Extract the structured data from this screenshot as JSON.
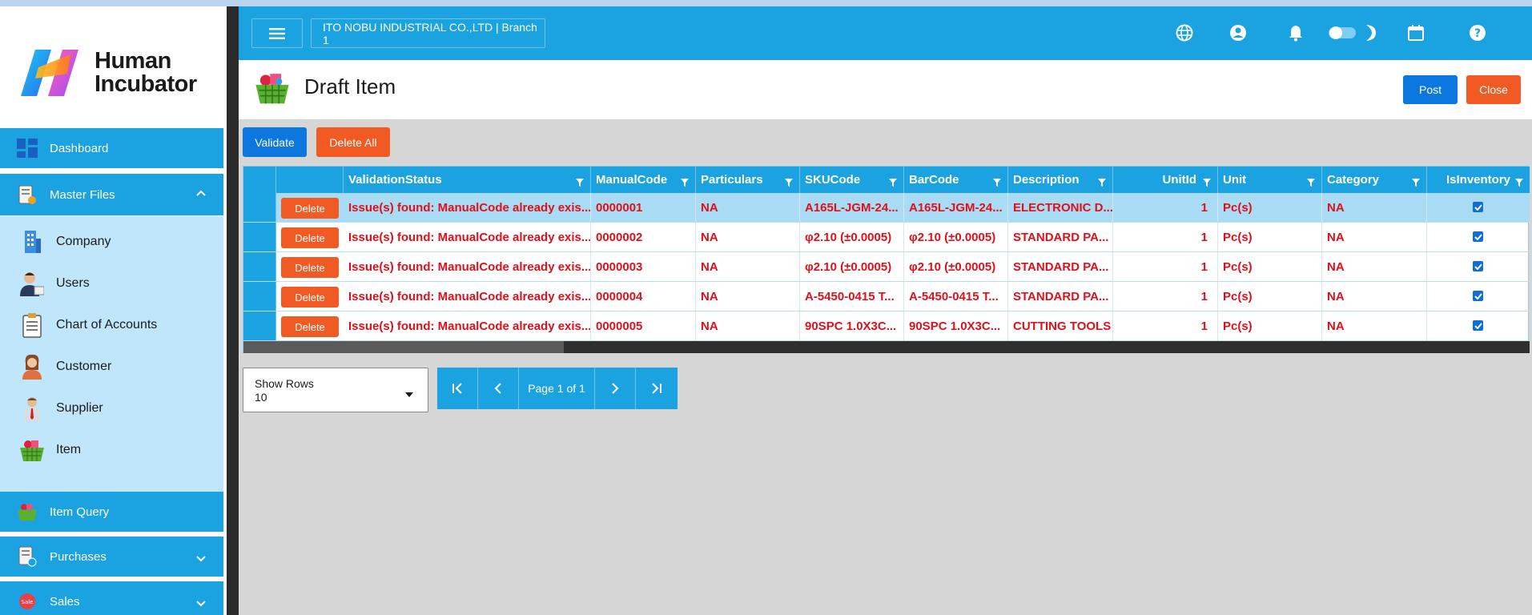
{
  "sidebar": {
    "logo_line1": "Human",
    "logo_line2": "Incubator",
    "top_items": [
      {
        "label": "Dashboard",
        "icon": "dashboard-icon"
      },
      {
        "label": "Master Files",
        "icon": "master-files-icon"
      }
    ],
    "sub_items": [
      {
        "label": "Company",
        "icon": "company-building-icon"
      },
      {
        "label": "Users",
        "icon": "users-icon"
      },
      {
        "label": "Chart of Accounts",
        "icon": "chart-of-accounts-icon"
      },
      {
        "label": "Customer",
        "icon": "customer-icon"
      },
      {
        "label": "Supplier",
        "icon": "supplier-icon"
      },
      {
        "label": "Item",
        "icon": "item-basket-icon"
      }
    ],
    "bottom_items": [
      {
        "label": "Item Query",
        "icon": "item-query-icon"
      },
      {
        "label": "Purchases",
        "icon": "purchases-icon"
      },
      {
        "label": "Sales",
        "icon": "sales-icon"
      }
    ]
  },
  "topbar": {
    "company": "ITO NOBU INDUSTRIAL CO.,LTD | Branch 1",
    "icons": [
      "globe-icon",
      "account-icon",
      "bell-icon",
      "theme-toggle-icon",
      "moon-icon",
      "calendar-icon",
      "help-icon"
    ]
  },
  "page": {
    "title": "Draft Item",
    "post_label": "Post",
    "close_label": "Close",
    "validate_label": "Validate",
    "delete_all_label": "Delete All"
  },
  "grid": {
    "columns": [
      "ValidationStatus",
      "ManualCode",
      "Particulars",
      "SKUCode",
      "BarCode",
      "Description",
      "UnitId",
      "Unit",
      "Category",
      "IsInventory"
    ],
    "delete_label": "Delete",
    "rows": [
      {
        "status": "Issue(s) found: ManualCode already exis...",
        "manual": "0000001",
        "particulars": "NA",
        "sku": "A165L-JGM-24...",
        "barcode": "A165L-JGM-24...",
        "description": "ELECTRONIC D...",
        "unitid": "1",
        "unit": "Pc(s)",
        "category": "NA",
        "inventory": true
      },
      {
        "status": "Issue(s) found: ManualCode already exis...",
        "manual": "0000002",
        "particulars": "NA",
        "sku": "φ2.10 (±0.0005)",
        "barcode": "φ2.10 (±0.0005)",
        "description": "STANDARD PA...",
        "unitid": "1",
        "unit": "Pc(s)",
        "category": "NA",
        "inventory": true
      },
      {
        "status": "Issue(s) found: ManualCode already exis...",
        "manual": "0000003",
        "particulars": "NA",
        "sku": "φ2.10 (±0.0005)",
        "barcode": "φ2.10 (±0.0005)",
        "description": "STANDARD PA...",
        "unitid": "1",
        "unit": "Pc(s)",
        "category": "NA",
        "inventory": true
      },
      {
        "status": "Issue(s) found: ManualCode already exis...",
        "manual": "0000004",
        "particulars": "NA",
        "sku": "A-5450-0415 T...",
        "barcode": "A-5450-0415 T...",
        "description": "STANDARD PA...",
        "unitid": "1",
        "unit": "Pc(s)",
        "category": "NA",
        "inventory": true
      },
      {
        "status": "Issue(s) found: ManualCode already exis...",
        "manual": "0000005",
        "particulars": "NA",
        "sku": "90SPC 1.0X3C...",
        "barcode": "90SPC 1.0X3C...",
        "description": "CUTTING TOOLS",
        "unitid": "1",
        "unit": "Pc(s)",
        "category": "NA",
        "inventory": true
      }
    ]
  },
  "pager": {
    "show_rows_label": "Show Rows",
    "show_rows_value": "10",
    "page_text": "Page 1 of 1"
  },
  "colors": {
    "primary": "#1aa3e0",
    "error_text": "#e0101a",
    "accent_orange": "#f15a22",
    "button_blue": "#0d77e0",
    "submenu_bg": "#bfe6fb"
  }
}
